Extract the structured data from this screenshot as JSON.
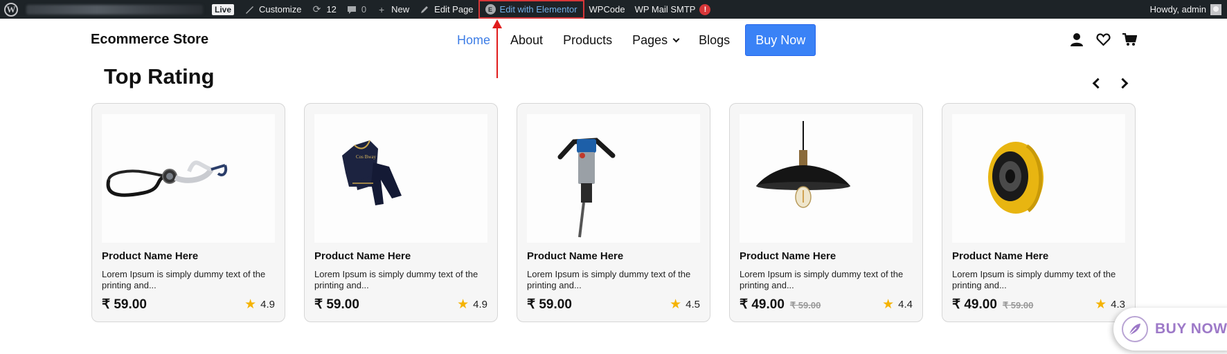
{
  "admin_bar": {
    "live_badge": "Live",
    "customize": "Customize",
    "updates_count": "12",
    "comments_count": "0",
    "new": "New",
    "edit_page": "Edit Page",
    "edit_with_elementor": "Edit with Elementor",
    "wpcode": "WPCode",
    "wp_mail_smtp": "WP Mail SMTP",
    "smtp_alert": "!",
    "howdy": "Howdy, admin"
  },
  "site": {
    "title": "Ecommerce Store",
    "nav": [
      "Home",
      "About",
      "Products",
      "Pages",
      "Blogs"
    ],
    "active_nav": "Home",
    "buy_now_label": "Buy Now",
    "accent_color": "#3a82f6"
  },
  "header_icons": [
    "user-icon",
    "heart-icon",
    "cart-icon"
  ],
  "section": {
    "title": "Top Rating",
    "prev_icon": "chevron-left-icon",
    "next_icon": "chevron-right-icon"
  },
  "products": [
    {
      "name": "Product Name Here",
      "desc": "Lorem Ipsum is simply dummy text of the printing and...",
      "price": "₹ 59.00",
      "old_price": "",
      "rating": "4.9",
      "image": "stethoscope"
    },
    {
      "name": "Product Name Here",
      "desc": "Lorem Ipsum is simply dummy text of the printing and...",
      "price": "₹ 59.00",
      "old_price": "",
      "rating": "4.9",
      "image": "kids-tracksuit"
    },
    {
      "name": "Product Name Here",
      "desc": "Lorem Ipsum is simply dummy text of the printing and...",
      "price": "₹ 59.00",
      "old_price": "",
      "rating": "4.5",
      "image": "jackhammer"
    },
    {
      "name": "Product Name Here",
      "desc": "Lorem Ipsum is simply dummy text of the printing and...",
      "price": "₹ 49.00",
      "old_price": "₹ 59.00",
      "rating": "4.4",
      "image": "pendant-lamp"
    },
    {
      "name": "Product Name Here",
      "desc": "Lorem Ipsum is simply dummy text of the printing and...",
      "price": "₹ 49.00",
      "old_price": "₹ 59.00",
      "rating": "4.3",
      "image": "yellow-speaker"
    }
  ],
  "floating_button": {
    "label": "BUY NOW",
    "icon": "feather-icon"
  }
}
